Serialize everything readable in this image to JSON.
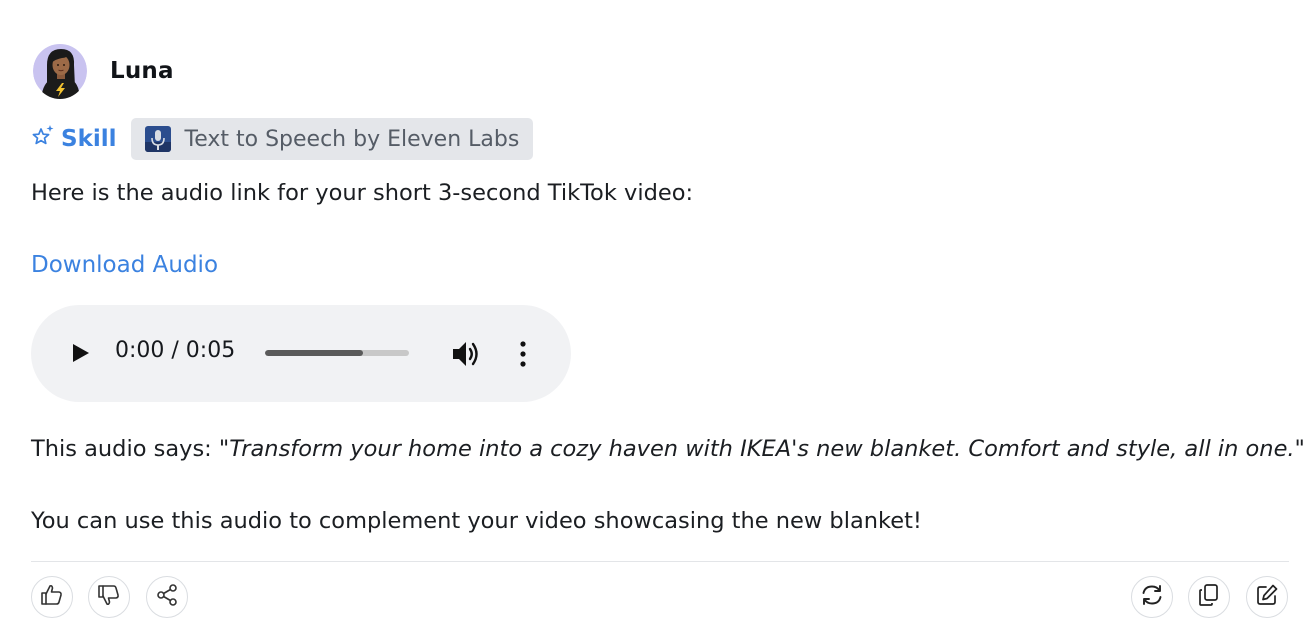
{
  "agent": {
    "name": "Luna",
    "avatar_icon": "woman-avatar-icon"
  },
  "skill": {
    "label": "Skill",
    "icon": "sparkle-star-icon",
    "chip_label": "Text to Speech by Eleven Labs",
    "chip_icon": "microphone-thumbnail-icon"
  },
  "message": {
    "intro": "Here is the audio link for your short 3-second TikTok video:",
    "download_label": "Download Audio",
    "says_label": "This audio says: ",
    "quote": "\"Transform your home into a cozy haven with IKEA's new blanket. Comfort and style, all in one.\"",
    "closing": "You can use this audio to complement your video showcasing the new blanket!"
  },
  "player": {
    "time_display": "0:00 / 0:05",
    "progress_fraction": 0.68,
    "play_icon": "play-icon",
    "volume_icon": "volume-icon",
    "more_icon": "more-vertical-icon"
  },
  "actions": {
    "left": [
      "thumbs-up-icon",
      "thumbs-down-icon",
      "share-icon"
    ],
    "right": [
      "regenerate-icon",
      "copy-icon",
      "edit-icon"
    ]
  },
  "colors": {
    "accent": "#3b82e0",
    "chip_bg": "#e4e6ea",
    "player_bg": "#f1f2f4"
  }
}
